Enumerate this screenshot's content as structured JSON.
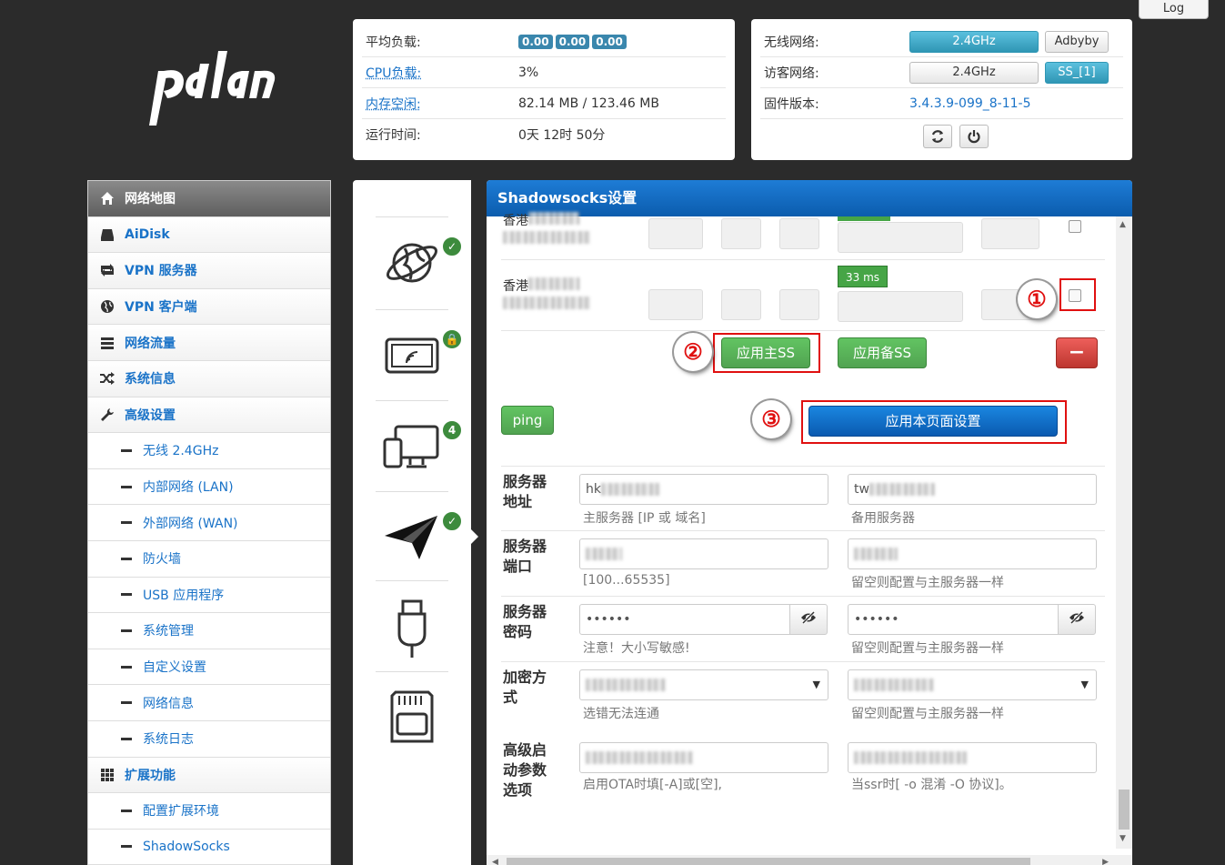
{
  "logout": "Log",
  "status": {
    "load_label": "平均负载:",
    "load_values": [
      "0.00",
      "0.00",
      "0.00"
    ],
    "cpu_label": "CPU负载:",
    "cpu_value": "3%",
    "mem_label": "内存空闲:",
    "mem_value": "82.14 MB / 123.46 MB",
    "uptime_label": "运行时间:",
    "uptime_value": "0天 12时 50分"
  },
  "wifi": {
    "wireless_label": "无线网络:",
    "wireless_btn": "2.4GHz",
    "adbyby_btn": "Adbyby",
    "guest_label": "访客网络:",
    "guest_btn": "2.4GHz",
    "ss_btn": "SS_[1]",
    "firmware_label": "固件版本:",
    "firmware_value": "3.4.3.9-099_8-11-5"
  },
  "sidebar": {
    "items": [
      {
        "label": "网络地图"
      },
      {
        "label": "AiDisk"
      },
      {
        "label": "VPN 服务器"
      },
      {
        "label": "VPN 客户端"
      },
      {
        "label": "网络流量"
      },
      {
        "label": "系统信息"
      },
      {
        "label": "高级设置"
      }
    ],
    "advanced": [
      "无线 2.4GHz",
      "内部网络 (LAN)",
      "外部网络 (WAN)",
      "防火墙",
      "USB 应用程序",
      "系统管理",
      "自定义设置",
      "网络信息",
      "系统日志"
    ],
    "ext_label": "扩展功能",
    "ext_items": [
      "配置扩展环境",
      "ShadowSocks"
    ]
  },
  "iconbar": {
    "badge_count": "4"
  },
  "main": {
    "title": "Shadowsocks设置",
    "row1_name": "香港",
    "row2_name": "香港",
    "ping_ms": "33 ms",
    "apply_main": "应用主SS",
    "apply_backup": "应用备SS",
    "remove": "−",
    "ping_btn": "ping",
    "apply_page": "应用本页面设置",
    "markers": [
      "①",
      "②",
      "③"
    ],
    "fields": {
      "addr_label": "服务器地址",
      "addr_main_value": "hk",
      "addr_backup_value": "tw",
      "addr_main_help": "主服务器 [IP 或 域名]",
      "addr_backup_help": "备用服务器",
      "port_label": "服务器端口",
      "port_main_help": "[100...65535]",
      "port_backup_help": "留空则配置与主服务器一样",
      "pwd_label": "服务器密码",
      "pwd_main_value": "••••••",
      "pwd_backup_value": "••••••",
      "pwd_main_help": "注意！大小写敏感!",
      "pwd_backup_help": "留空则配置与主服务器一样",
      "enc_label": "加密方式",
      "enc_main_help": "选错无法连通",
      "enc_backup_help": "留空则配置与主服务器一样",
      "adv_label": "高级启动参数选项",
      "adv_main_help": "启用OTA时填[-A]或[空],",
      "adv_backup_help": "当ssr时[ -o 混淆 -O 协议]。"
    }
  }
}
